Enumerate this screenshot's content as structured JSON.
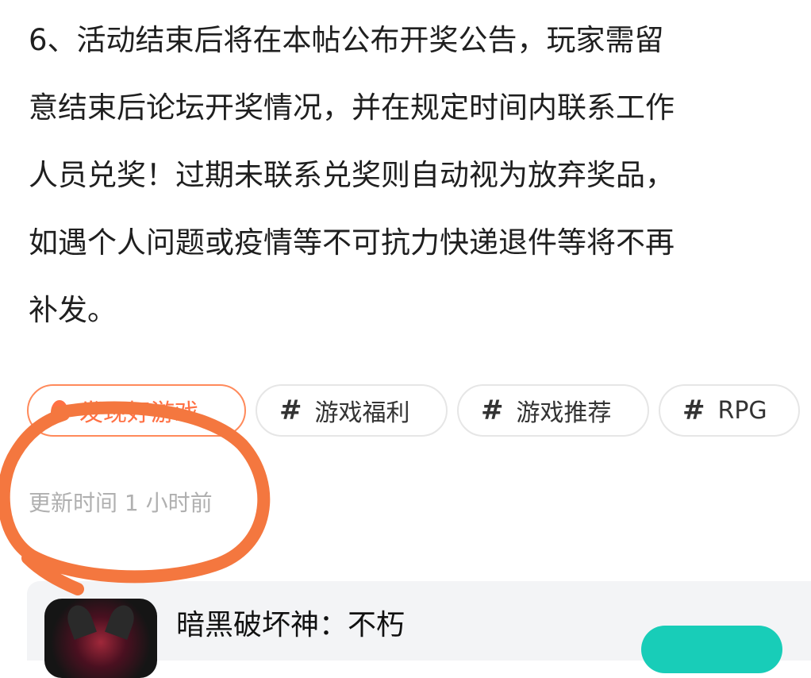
{
  "post": {
    "lines": [
      "6、活动结束后将在本帖公布开奖公告，玩家需留",
      "意结束后论坛开奖情况，并在规定时间内联系工作",
      "人员兑奖！过期未联系兑奖则自动视为放弃奖品，",
      "如遇个人问题或疫情等不可抗力快递退件等将不再",
      "补发。"
    ]
  },
  "tags": [
    {
      "label": "发现好游戏",
      "icon": "flame-icon",
      "highlight": true
    },
    {
      "label": "游戏福利",
      "icon": "hash-icon"
    },
    {
      "label": "游戏推荐",
      "icon": "hash-icon"
    },
    {
      "label": "RPG",
      "icon": "hash-icon"
    }
  ],
  "tag_hash": "#",
  "update_time": "更新时间 1 小时前",
  "game_card": {
    "title": "暗黑破坏神：不朽"
  },
  "colors": {
    "accent_orange": "#ff7043",
    "annotation_stroke": "#f4773f",
    "download_button": "#18cdb8"
  }
}
